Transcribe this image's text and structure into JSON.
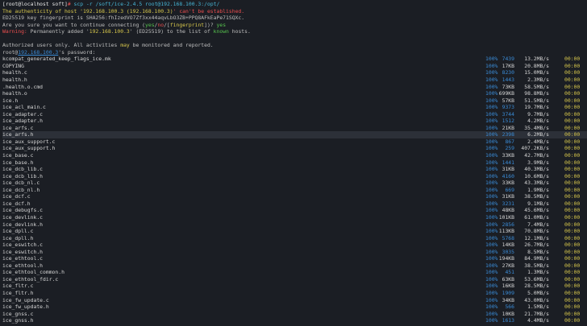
{
  "prompt": {
    "user_host": "[root@localhost soft]",
    "symbol": "#",
    "command": "scp -r /soft/ice-2.4.5 root@192.168.100.3:/opt/"
  },
  "ssh": {
    "line1_a": "The authenticity of host '",
    "line1_ip": "192.168.100.3 (192.168.100.3)",
    "line1_b": "' can't be established.",
    "line2": "ED25519 key fingerprint is SHA256:fhIzedVO7Zf3xx44aqvLbO3ZB+PPQ8AFkEaPe71SQXc.",
    "line3_a": "Are you sure you want to continue connecting (",
    "line3_yes": "yes",
    "line3_sep1": "/",
    "line3_no": "no",
    "line3_sep2": "/[",
    "line3_fp": "fingerprint",
    "line3_b": "])? ",
    "line3_answer": "yes",
    "warn_label": "Warning:",
    "warn_a": " Permanently added '",
    "warn_ip": "192.168.100.3",
    "warn_b": "' (ED25519) to the list of ",
    "warn_known": "known",
    "warn_c": " hosts.",
    "auth_a": "Authorized users only. All activities ",
    "auth_may": "may",
    "auth_b": " be monitored and reported.",
    "pw_user": "root@",
    "pw_ip": "192.168.100.3",
    "pw_b": "'s password:"
  },
  "transfers": [
    {
      "name": "kcompat_generated_keep_flags_ice.mk",
      "pct": "100%",
      "size": "7439",
      "size_blue": true,
      "rate": "13.2MB/s",
      "time": "00:00"
    },
    {
      "name": "COPYING",
      "pct": "100%",
      "size": "17KB",
      "size_blue": false,
      "rate": "20.8MB/s",
      "time": "00:00"
    },
    {
      "name": "health.c",
      "pct": "100%",
      "size": "8230",
      "size_blue": true,
      "rate": "15.0MB/s",
      "time": "00:00"
    },
    {
      "name": "health.h",
      "pct": "100%",
      "size": "1443",
      "size_blue": true,
      "rate": "2.3MB/s",
      "time": "00:00"
    },
    {
      "name": ".health.o.cmd",
      "pct": "100%",
      "size": "73KB",
      "size_blue": false,
      "rate": "58.5MB/s",
      "time": "00:00"
    },
    {
      "name": "health.o",
      "pct": "100%",
      "size": "699KB",
      "size_blue": false,
      "rate": "98.8MB/s",
      "time": "00:00"
    },
    {
      "name": "ice.h",
      "pct": "100%",
      "size": "57KB",
      "size_blue": false,
      "rate": "51.5MB/s",
      "time": "00:00"
    },
    {
      "name": "ice_acl_main.c",
      "pct": "100%",
      "size": "9373",
      "size_blue": true,
      "rate": "19.7MB/s",
      "time": "00:00"
    },
    {
      "name": "ice_adapter.c",
      "pct": "100%",
      "size": "3744",
      "size_blue": true,
      "rate": "9.7MB/s",
      "time": "00:00"
    },
    {
      "name": "ice_adapter.h",
      "pct": "100%",
      "size": "1512",
      "size_blue": true,
      "rate": "4.2MB/s",
      "time": "00:00"
    },
    {
      "name": "ice_arfs.c",
      "pct": "100%",
      "size": "21KB",
      "size_blue": false,
      "rate": "35.4MB/s",
      "time": "00:00"
    },
    {
      "name": "ice_arfs.h",
      "pct": "100%",
      "size": "2398",
      "size_blue": true,
      "rate": "6.2MB/s",
      "time": "00:00",
      "highlight": true
    },
    {
      "name": "ice_aux_support.c",
      "pct": "100%",
      "size": "867",
      "size_blue": true,
      "rate": "2.4MB/s",
      "time": "00:00"
    },
    {
      "name": "ice_aux_support.h",
      "pct": "100%",
      "size": "259",
      "size_blue": true,
      "rate": "407.2KB/s",
      "time": "00:00"
    },
    {
      "name": "ice_base.c",
      "pct": "100%",
      "size": "33KB",
      "size_blue": false,
      "rate": "42.7MB/s",
      "time": "00:00"
    },
    {
      "name": "ice_base.h",
      "pct": "100%",
      "size": "1441",
      "size_blue": true,
      "rate": "3.9MB/s",
      "time": "00:00"
    },
    {
      "name": "ice_dcb_lib.c",
      "pct": "100%",
      "size": "31KB",
      "size_blue": false,
      "rate": "40.3MB/s",
      "time": "00:00"
    },
    {
      "name": "ice_dcb_lib.h",
      "pct": "100%",
      "size": "4160",
      "size_blue": true,
      "rate": "10.6MB/s",
      "time": "00:00"
    },
    {
      "name": "ice_dcb_nl.c",
      "pct": "100%",
      "size": "33KB",
      "size_blue": false,
      "rate": "43.3MB/s",
      "time": "00:00"
    },
    {
      "name": "ice_dcb_nl.h",
      "pct": "100%",
      "size": "669",
      "size_blue": true,
      "rate": "1.9MB/s",
      "time": "00:00"
    },
    {
      "name": "ice_dcf.c",
      "pct": "100%",
      "size": "31KB",
      "size_blue": false,
      "rate": "38.5MB/s",
      "time": "00:00"
    },
    {
      "name": "ice_dcf.h",
      "pct": "100%",
      "size": "3231",
      "size_blue": true,
      "rate": "9.1MB/s",
      "time": "00:00"
    },
    {
      "name": "ice_debugfs.c",
      "pct": "100%",
      "size": "48KB",
      "size_blue": false,
      "rate": "45.6MB/s",
      "time": "00:00"
    },
    {
      "name": "ice_devlink.c",
      "pct": "100%",
      "size": "101KB",
      "size_blue": false,
      "rate": "61.0MB/s",
      "time": "00:00"
    },
    {
      "name": "ice_devlink.h",
      "pct": "100%",
      "size": "2856",
      "size_blue": true,
      "rate": "7.4MB/s",
      "time": "00:00"
    },
    {
      "name": "ice_dpll.c",
      "pct": "100%",
      "size": "113KB",
      "size_blue": false,
      "rate": "70.8MB/s",
      "time": "00:00"
    },
    {
      "name": "ice_dpll.h",
      "pct": "100%",
      "size": "5768",
      "size_blue": true,
      "rate": "12.1MB/s",
      "time": "00:00"
    },
    {
      "name": "ice_eswitch.c",
      "pct": "100%",
      "size": "14KB",
      "size_blue": false,
      "rate": "26.7MB/s",
      "time": "00:00"
    },
    {
      "name": "ice_eswitch.h",
      "pct": "100%",
      "size": "3035",
      "size_blue": true,
      "rate": "8.5MB/s",
      "time": "00:00"
    },
    {
      "name": "ice_ethtool.c",
      "pct": "100%",
      "size": "194KB",
      "size_blue": false,
      "rate": "84.9MB/s",
      "time": "00:00"
    },
    {
      "name": "ice_ethtool.h",
      "pct": "100%",
      "size": "27KB",
      "size_blue": false,
      "rate": "38.5MB/s",
      "time": "00:00"
    },
    {
      "name": "ice_ethtool_common.h",
      "pct": "100%",
      "size": "451",
      "size_blue": true,
      "rate": "1.3MB/s",
      "time": "00:00"
    },
    {
      "name": "ice_ethtool_fdir.c",
      "pct": "100%",
      "size": "63KB",
      "size_blue": false,
      "rate": "53.6MB/s",
      "time": "00:00"
    },
    {
      "name": "ice_fltr.c",
      "pct": "100%",
      "size": "16KB",
      "size_blue": false,
      "rate": "28.5MB/s",
      "time": "00:00"
    },
    {
      "name": "ice_fltr.h",
      "pct": "100%",
      "size": "1909",
      "size_blue": true,
      "rate": "5.0MB/s",
      "time": "00:00"
    },
    {
      "name": "ice_fw_update.c",
      "pct": "100%",
      "size": "34KB",
      "size_blue": false,
      "rate": "43.0MB/s",
      "time": "00:00"
    },
    {
      "name": "ice_fw_update.h",
      "pct": "100%",
      "size": "566",
      "size_blue": true,
      "rate": "1.5MB/s",
      "time": "00:00"
    },
    {
      "name": "ice_gnss.c",
      "pct": "100%",
      "size": "10KB",
      "size_blue": false,
      "rate": "21.7MB/s",
      "time": "00:00"
    },
    {
      "name": "ice_gnss.h",
      "pct": "100%",
      "size": "1613",
      "size_blue": true,
      "rate": "4.4MB/s",
      "time": "00:00"
    }
  ]
}
